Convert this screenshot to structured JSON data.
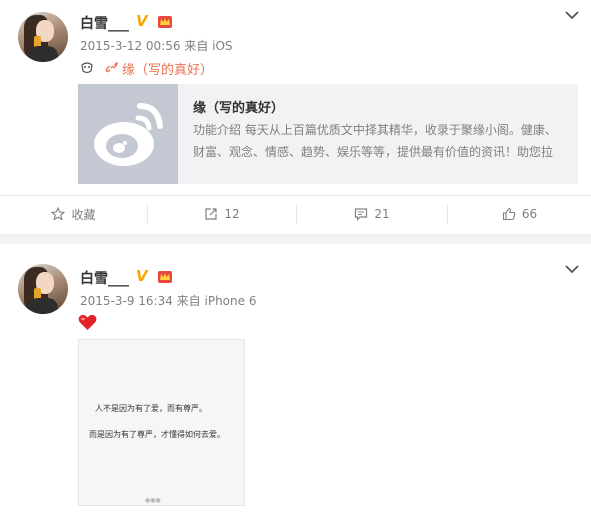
{
  "post1": {
    "username": "白雪___",
    "verified_badge": "V",
    "meta": "2015-3-12 00:56 来自 iOS",
    "link_text": "缘（写的真好）",
    "card": {
      "title": "缘（写的真好）",
      "description": "功能介绍 每天从上百篇优质文中择其精华，收录于聚缘小阁。健康、财富、观念、情感、趋势、娱乐等等，提供最有价值的资讯！助您拉"
    },
    "actions": {
      "favorite_label": "收藏",
      "repost_count": "12",
      "comment_count": "21",
      "like_count": "66"
    }
  },
  "post2": {
    "username": "白雪___",
    "verified_badge": "V",
    "meta": "2015-3-9 16:34 来自 iPhone 6",
    "emoji": "heart",
    "image_text": {
      "line1": "人不是因为有了爱，而有尊严。",
      "line2": "而是因为有了尊严，才懂得如何去爱。"
    }
  },
  "colors": {
    "link": "#eb7350",
    "verified": "#f7a800",
    "meta_text": "#808080",
    "card_bg": "#f2f2f5",
    "separator": "#f2f2f2"
  },
  "icons": [
    "chevron-down-icon",
    "verified-icon",
    "crown-icon",
    "link-icon",
    "weibo-logo-icon",
    "star-icon",
    "repost-icon",
    "comment-icon",
    "like-icon",
    "heart-icon"
  ]
}
